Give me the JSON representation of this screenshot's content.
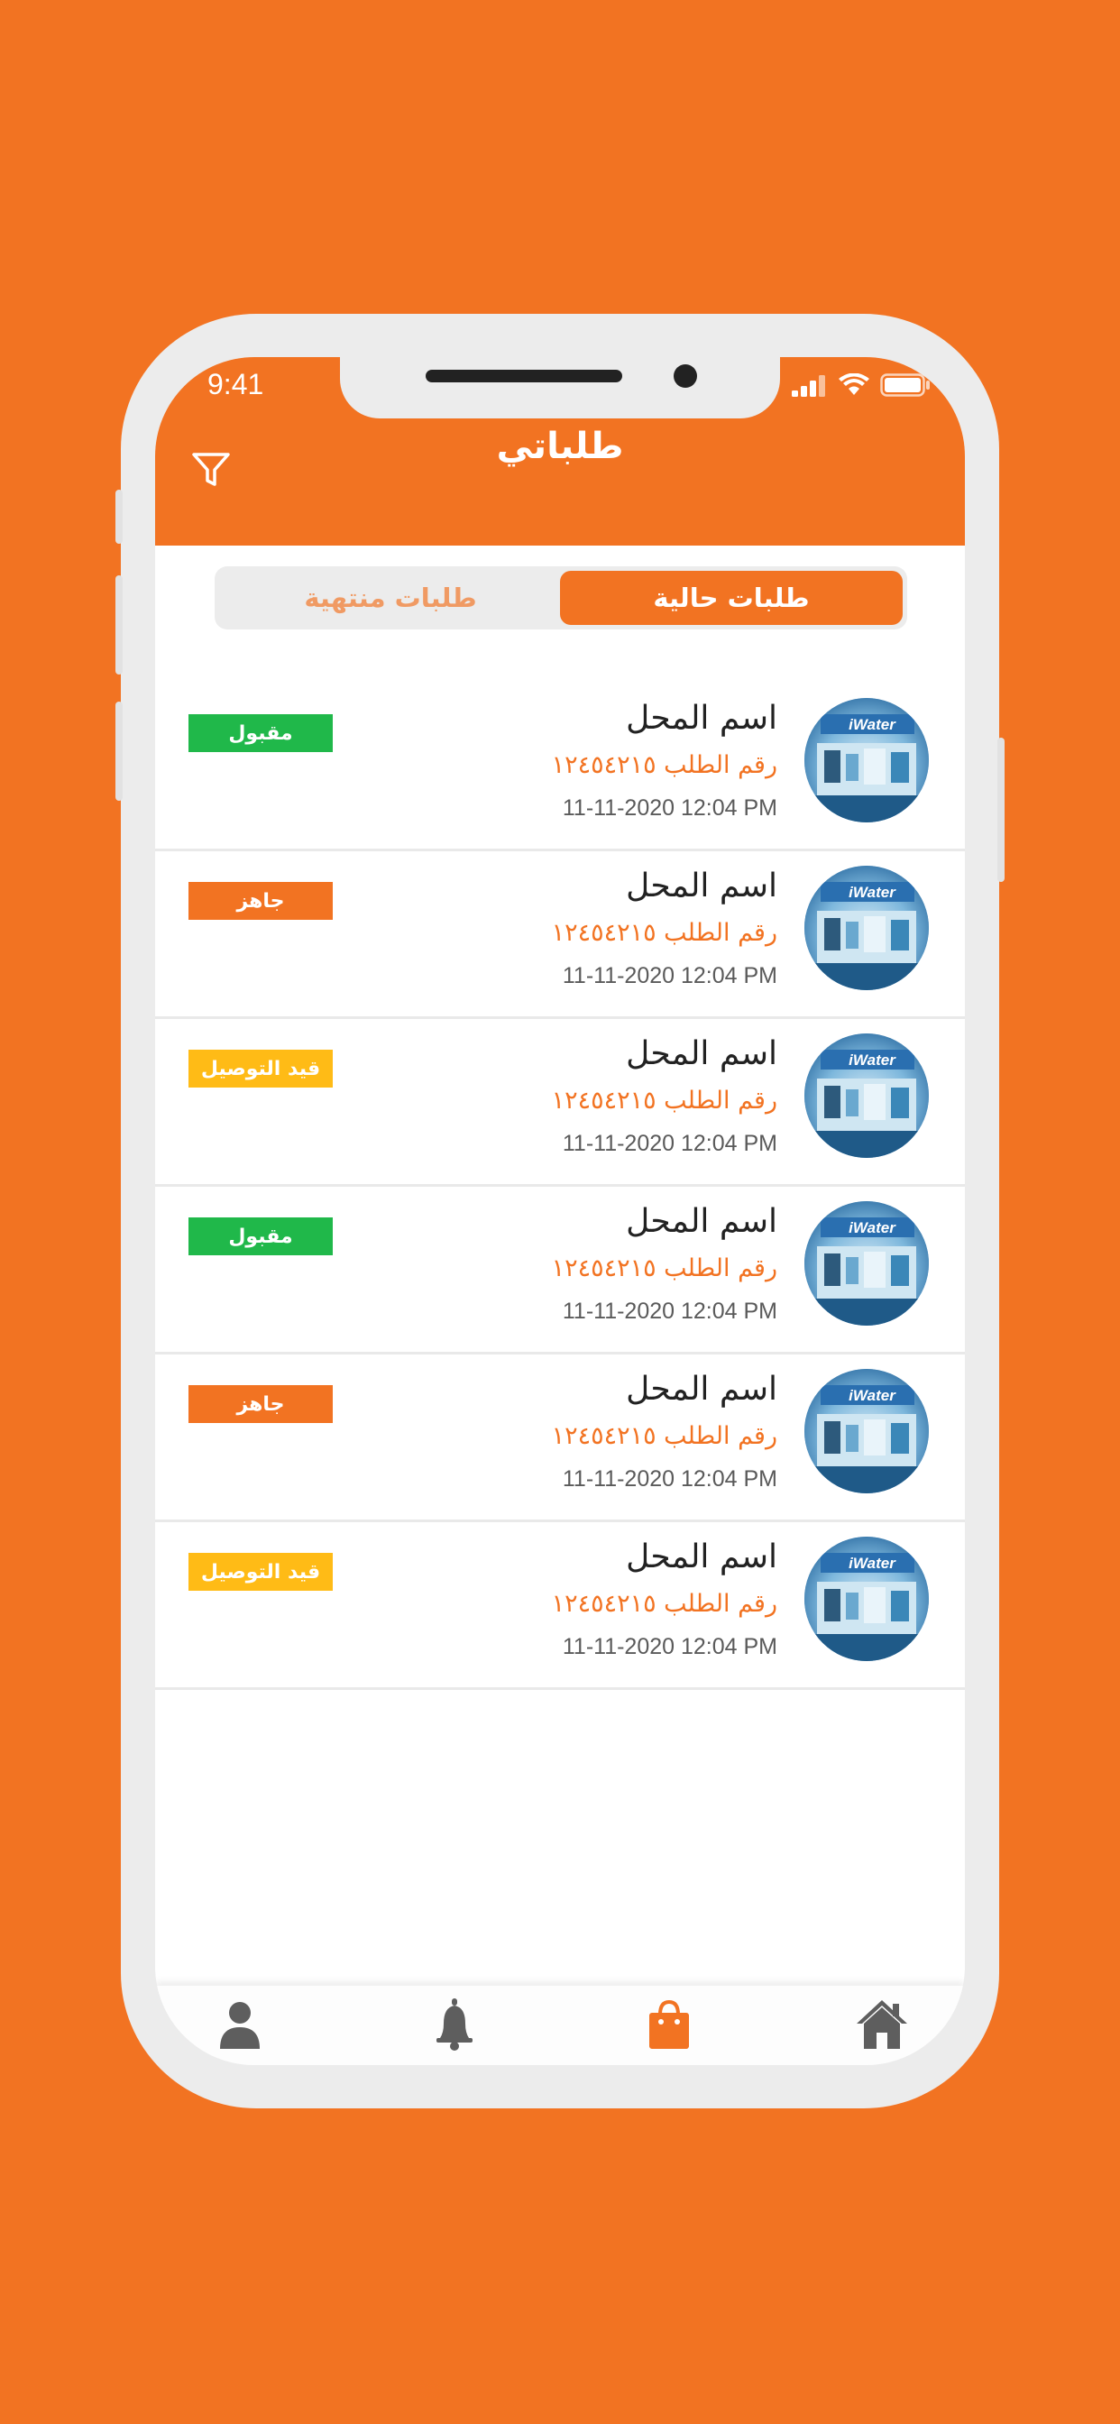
{
  "status_bar": {
    "time": "9:41"
  },
  "header": {
    "title": "طلباتي"
  },
  "tabs": {
    "current": "طلبات حالية",
    "finished": "طلبات منتهية"
  },
  "colors": {
    "accent": "#f27322",
    "accepted": "#20b84a",
    "ready": "#f27322",
    "delivering": "#ffbb16"
  },
  "orders": [
    {
      "store_name": "اسم المحل",
      "order_number": "رقم الطلب ١٢٤٥٤٢١٥",
      "date": "11-11-2020  12:04 PM",
      "status": "مقبول",
      "status_color": "#20b84a",
      "image_label": "iWater"
    },
    {
      "store_name": "اسم المحل",
      "order_number": "رقم الطلب ١٢٤٥٤٢١٥",
      "date": "11-11-2020  12:04 PM",
      "status": "جاهز",
      "status_color": "#f27322",
      "image_label": "iWater"
    },
    {
      "store_name": "اسم المحل",
      "order_number": "رقم الطلب ١٢٤٥٤٢١٥",
      "date": "11-11-2020  12:04 PM",
      "status": "قيد التوصيل",
      "status_color": "#ffbb16",
      "image_label": "iWater"
    },
    {
      "store_name": "اسم المحل",
      "order_number": "رقم الطلب ١٢٤٥٤٢١٥",
      "date": "11-11-2020  12:04 PM",
      "status": "مقبول",
      "status_color": "#20b84a",
      "image_label": "iWater"
    },
    {
      "store_name": "اسم المحل",
      "order_number": "رقم الطلب ١٢٤٥٤٢١٥",
      "date": "11-11-2020  12:04 PM",
      "status": "جاهز",
      "status_color": "#f27322",
      "image_label": "iWater"
    },
    {
      "store_name": "اسم المحل",
      "order_number": "رقم الطلب ١٢٤٥٤٢١٥",
      "date": "11-11-2020  12:04 PM",
      "status": "قيد التوصيل",
      "status_color": "#ffbb16",
      "image_label": "iWater"
    }
  ],
  "bottom_nav": [
    {
      "icon": "user-icon",
      "active": false
    },
    {
      "icon": "bell-icon",
      "active": false
    },
    {
      "icon": "shopping-bag-icon",
      "active": true
    },
    {
      "icon": "home-icon",
      "active": false
    }
  ]
}
